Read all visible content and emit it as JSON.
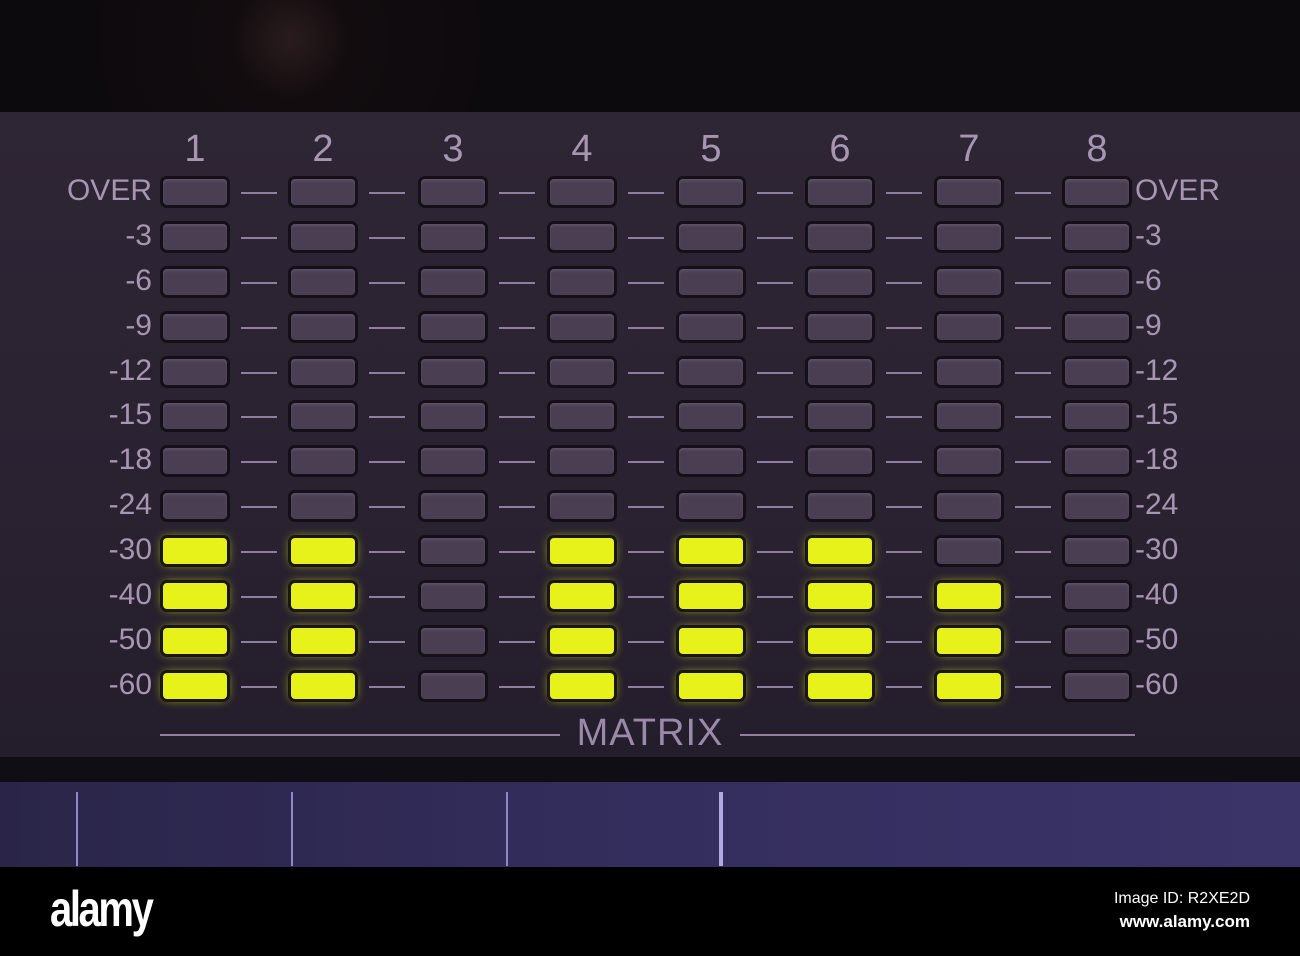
{
  "channels": [
    "1",
    "2",
    "3",
    "4",
    "5",
    "6",
    "7",
    "8"
  ],
  "scale_labels_left": [
    "OVER",
    "-3",
    "-6",
    "-9",
    "-12",
    "-15",
    "-18",
    "-24",
    "-30",
    "-40",
    "-50",
    "-60"
  ],
  "scale_labels_right": [
    "OVER",
    "-3",
    "-6",
    "-9",
    "-12",
    "-15",
    "-18",
    "-24",
    "-30",
    "-40",
    "-50",
    "-60"
  ],
  "lit_segments_per_channel": [
    4,
    4,
    0,
    4,
    4,
    4,
    3,
    0
  ],
  "panel_title": "MATRIX",
  "footer": {
    "logo": "alamy",
    "image_id": "Image ID: R2XE2D",
    "site": "www.alamy.com"
  },
  "colors": {
    "led_on": "#e6f21a",
    "led_off": "#4a3f52",
    "panel": "#2a2231"
  }
}
